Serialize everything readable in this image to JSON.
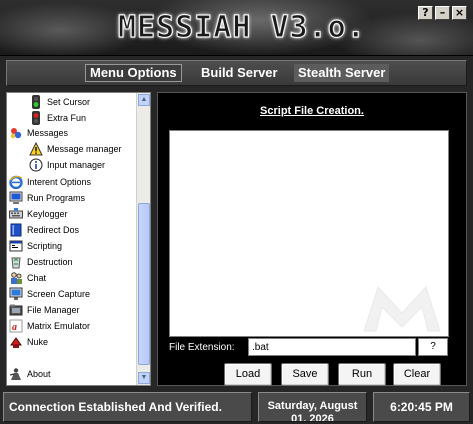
{
  "banner": {
    "title": "MESSIAH V3.o."
  },
  "window_controls": {
    "help": "?",
    "minimize": "–",
    "close": "×"
  },
  "tabs": [
    {
      "label": "Menu Options",
      "selected": true
    },
    {
      "label": "Build Server",
      "selected": false
    },
    {
      "label": "Stealth Server",
      "selected": false
    }
  ],
  "sidebar": {
    "items": [
      {
        "label": "Set Cursor",
        "icon": "traffic-light-green-icon",
        "level": 1
      },
      {
        "label": "Extra Fun",
        "icon": "traffic-light-red-icon",
        "level": 1
      },
      {
        "label": "Messages",
        "icon": "messages-icon",
        "level": 0
      },
      {
        "label": "Message manager",
        "icon": "warning-icon",
        "level": 1
      },
      {
        "label": "Input manager",
        "icon": "info-icon",
        "level": 1
      },
      {
        "label": "Interent Options",
        "icon": "internet-explorer-icon",
        "level": 0
      },
      {
        "label": "Run Programs",
        "icon": "computer-icon",
        "level": 0
      },
      {
        "label": "Keylogger",
        "icon": "keyboard-icon",
        "level": 0
      },
      {
        "label": "Redirect Dos",
        "icon": "book-icon",
        "level": 0
      },
      {
        "label": "Scripting",
        "icon": "script-window-icon",
        "level": 0
      },
      {
        "label": "Destruction",
        "icon": "recycle-bin-icon",
        "level": 0
      },
      {
        "label": "Chat",
        "icon": "chat-icon",
        "level": 0
      },
      {
        "label": "Screen Capture",
        "icon": "monitor-icon",
        "level": 0
      },
      {
        "label": "File Manager",
        "icon": "folder-icon",
        "level": 0
      },
      {
        "label": "Matrix Emulator",
        "icon": "matrix-icon",
        "level": 0
      },
      {
        "label": "Nuke",
        "icon": "nuke-icon",
        "level": 0
      },
      {
        "label": "About",
        "icon": "about-icon",
        "level": 0
      }
    ]
  },
  "main": {
    "title": "Script File Creation.",
    "script_text": "",
    "extension_label": "File Extension:",
    "extension_value": ".bat",
    "help_label": "?",
    "buttons": {
      "load": "Load",
      "save": "Save",
      "run": "Run",
      "clear": "Clear"
    }
  },
  "status": {
    "connection": "Connection Established And Verified.",
    "date": "Saturday, August 01, 2026",
    "time": "6:20:45 PM"
  },
  "colors": {
    "background": "#262626",
    "panel": "#000000",
    "status_box": "#4a4a4a",
    "accent_text": "#ffffff"
  }
}
